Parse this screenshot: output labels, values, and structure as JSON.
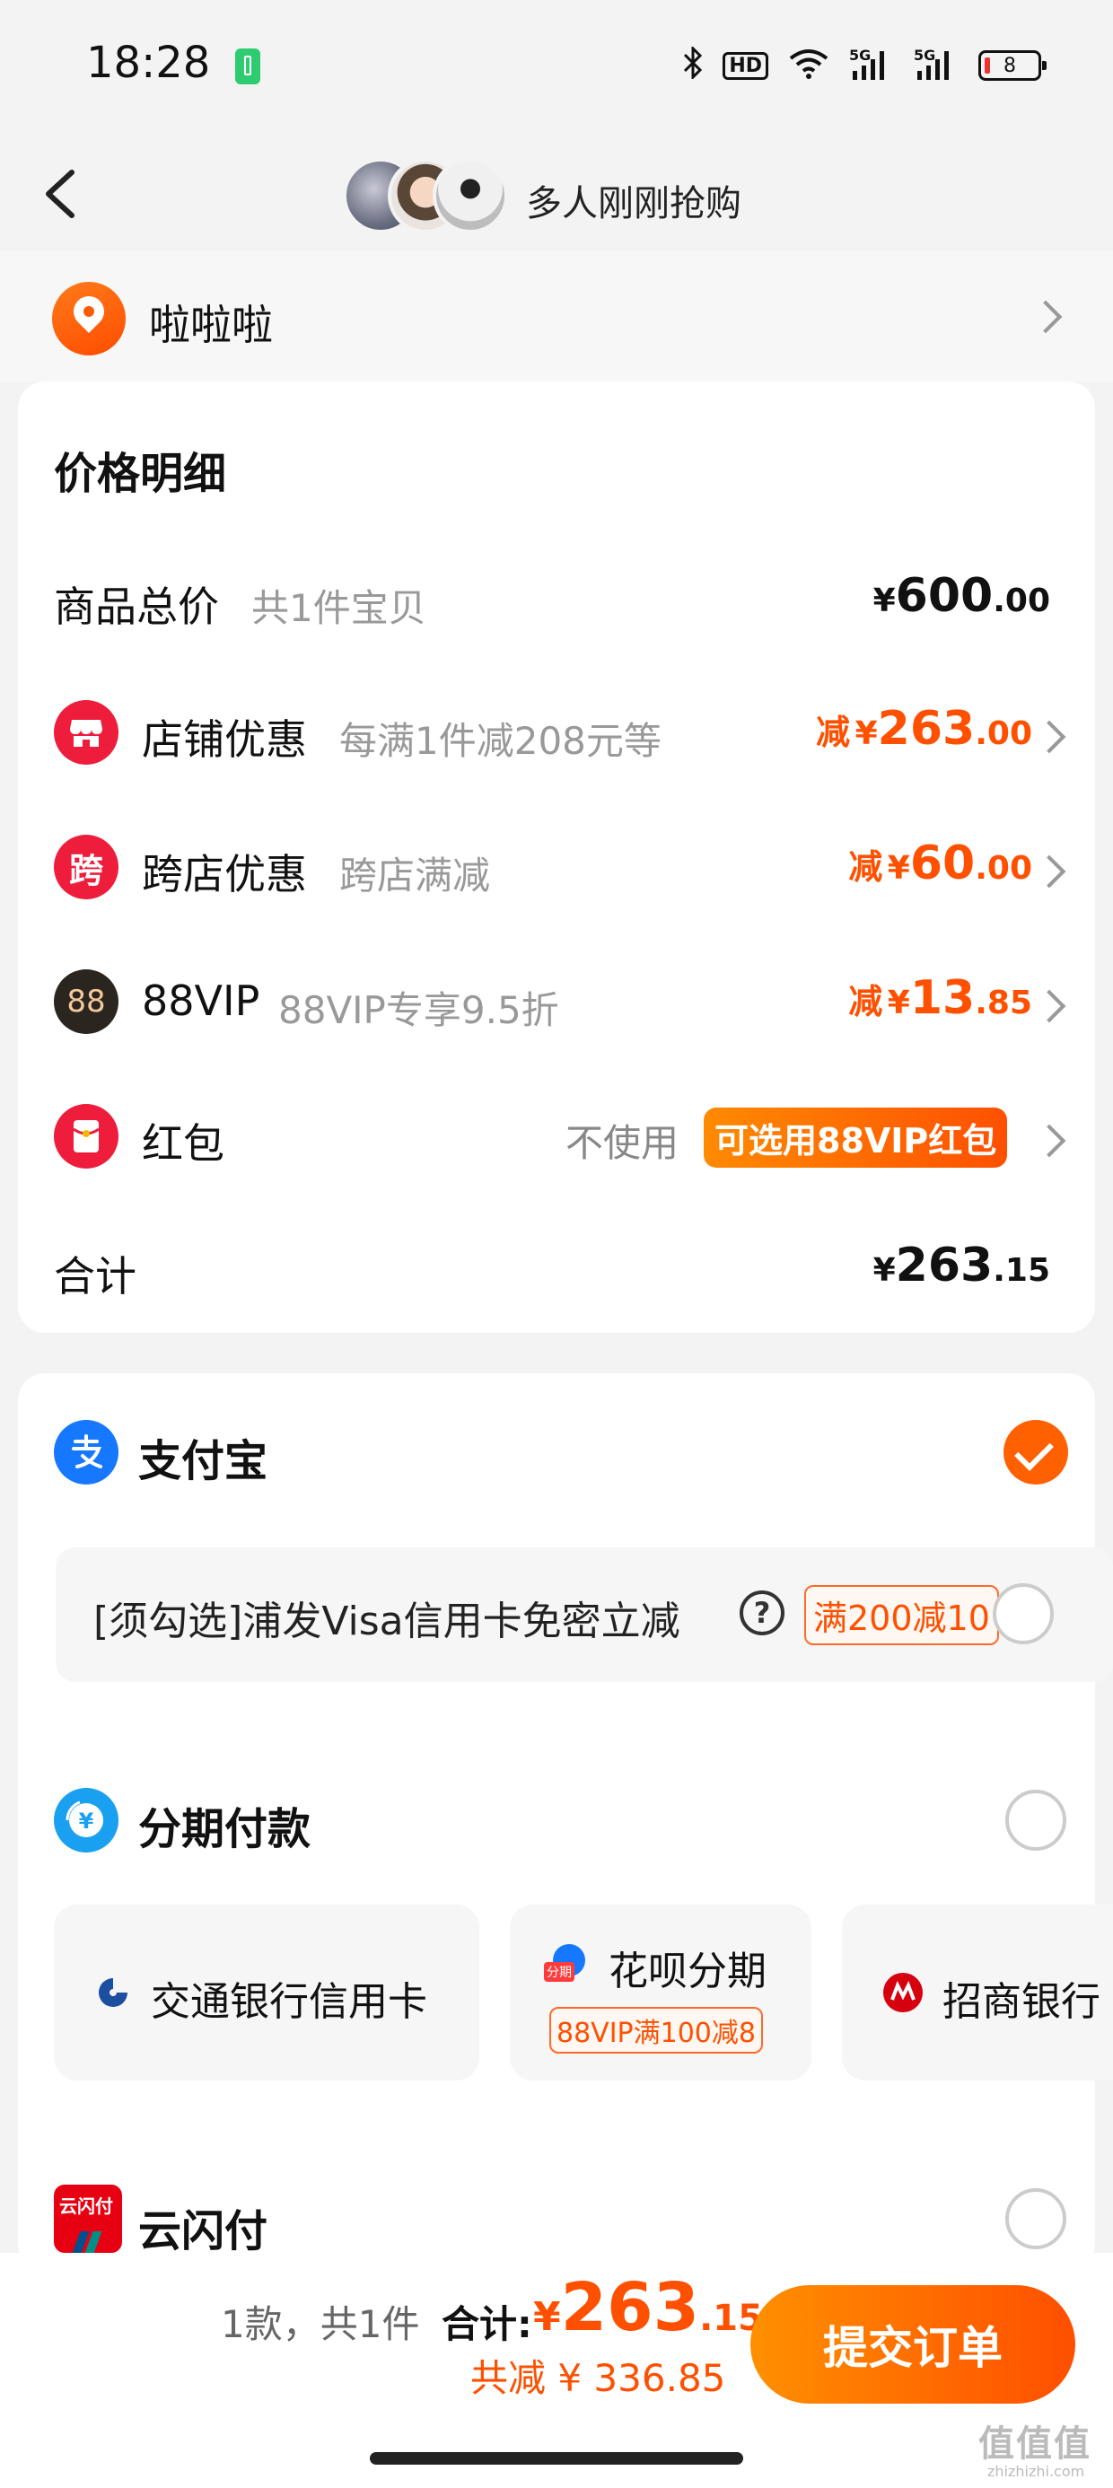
{
  "status_bar": {
    "time": "18:28",
    "battery_level": "8",
    "icons": [
      "bluetooth-icon",
      "hd-icon",
      "wifi-icon",
      "5g-signal-icon",
      "5g-signal-icon",
      "battery-icon"
    ]
  },
  "header": {
    "title": "多人刚刚抢购"
  },
  "address": {
    "name": "啦啦啦"
  },
  "price_detail": {
    "title": "价格明细",
    "rows": [
      {
        "label": "商品总价",
        "sub": "共1件宝贝",
        "currency": "¥",
        "int": "600",
        "dec": ".00"
      },
      {
        "label": "店铺优惠",
        "sub": "每满1件减208元等",
        "prefix": "减",
        "currency": "¥",
        "int": "263",
        "dec": ".00"
      },
      {
        "label": "跨店优惠",
        "sub": "跨店满减",
        "prefix": "减",
        "currency": "¥",
        "int": "60",
        "dec": ".00"
      },
      {
        "label": "88VIP",
        "sub": "88VIP专享9.5折",
        "prefix": "减",
        "currency": "¥",
        "int": "13",
        "dec": ".85"
      },
      {
        "label": "红包",
        "value_text": "不使用",
        "pill": "可选用88VIP红包"
      },
      {
        "label": "合计",
        "currency": "¥",
        "int": "263",
        "dec": ".15"
      }
    ],
    "icon_glyphs": {
      "cross_store": "跨",
      "vip": "88"
    }
  },
  "payment": {
    "alipay": {
      "label": "支付宝",
      "selected": true
    },
    "alipay_promo": {
      "text": "[须勾选]浦发Visa信用卡免密立减",
      "tag": "满200减10"
    },
    "installment": {
      "label": "分期付款",
      "options": [
        {
          "label": "交通银行信用卡"
        },
        {
          "label": "花呗分期",
          "tag": "88VIP满100减8"
        },
        {
          "label": "招商银行"
        }
      ],
      "huabei_badge": "分期"
    },
    "unionpay": {
      "label": "云闪付",
      "logo_text": "云闪付"
    }
  },
  "bottom_bar": {
    "count_text": "1款，共1件",
    "total_label": "合计:",
    "currency": "¥",
    "total_int": "263",
    "total_dec": ".15",
    "saved_text": "共减 ¥ 336.85",
    "submit_label": "提交订单"
  },
  "watermark": {
    "text": "值值值",
    "sub": "zhizhizhi.com"
  },
  "colors": {
    "accent": "#ff5000",
    "bg": "#f3f3f3",
    "alipay_blue": "#1677ff"
  }
}
